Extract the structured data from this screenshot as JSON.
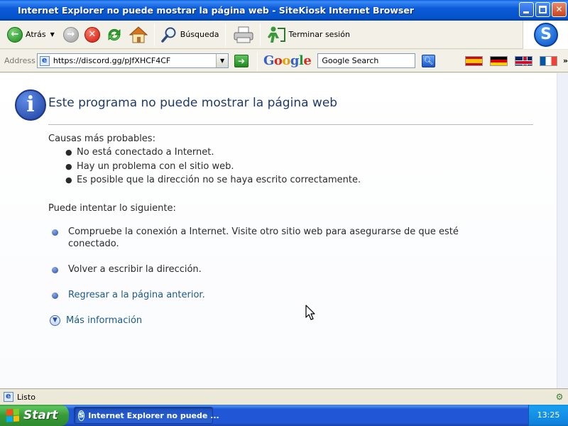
{
  "window": {
    "title": "Internet Explorer no puede mostrar la página web - SiteKiosk Internet Browser"
  },
  "toolbar": {
    "back_label": "Atrás",
    "search_label": "Búsqueda",
    "end_session_label": "Terminar sesión",
    "logo_letter": "S"
  },
  "address_bar": {
    "label": "Address",
    "url": "https://discord.gg/pJfXHCF4CF",
    "google_search_placeholder": "Google Search",
    "flags": [
      "spain-flag",
      "germany-flag",
      "uk-flag",
      "france-flag"
    ]
  },
  "page": {
    "title": "Este programa no puede mostrar la página web",
    "causes_heading": "Causas más probables:",
    "causes": [
      "No está conectado a Internet.",
      "Hay un problema con el sitio web.",
      "Es posible que la dirección no se haya escrito correctamente."
    ],
    "try_heading": "Puede intentar lo siguiente:",
    "try_items": [
      "Compruebe la conexión a Internet. Visite otro sitio web para asegurarse de que esté conectado.",
      "Volver a escribir la dirección.",
      "Regresar a la página anterior.",
      "Más información"
    ]
  },
  "statusbar": {
    "text": "Listo"
  },
  "taskbar": {
    "start_label": "Start",
    "task_label": "Internet Explorer no puede ...",
    "clock": "13:25"
  },
  "colors": {
    "title_bar": "#0453c9",
    "link": "#1a5a8c",
    "page_title": "#1f3a6a"
  }
}
